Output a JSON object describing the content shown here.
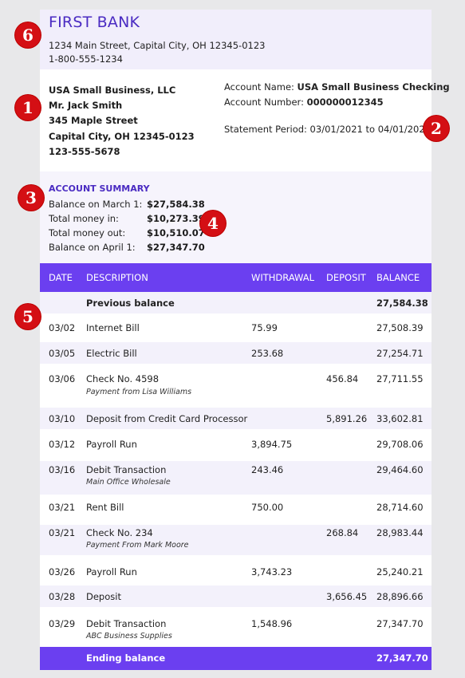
{
  "bank": {
    "name": "FIRST BANK",
    "address": "1234 Main Street, Capital City, OH 12345-0123",
    "phone": "1-800-555-1234"
  },
  "customer": {
    "business": "USA Small Business, LLC",
    "contact": "Mr. Jack Smith",
    "street": "345 Maple Street",
    "city": "Capital City, OH 12345-0123",
    "phone": "123-555-5678"
  },
  "account": {
    "name_label": "Account Name:",
    "name_value": "USA Small Business Checking",
    "number_label": "Account Number:",
    "number_value": "000000012345",
    "period": "Statement Period: 03/01/2021 to 04/01/2021"
  },
  "summary": {
    "title": "ACCOUNT SUMMARY",
    "items": [
      {
        "label": "Balance on March 1:",
        "value": "$27,584.38"
      },
      {
        "label": "Total money in:",
        "value": "$10,273.39"
      },
      {
        "label": "Total money out:",
        "value": "$10,510.07"
      },
      {
        "label": "Balance on April 1:",
        "value": "$27,347.70"
      }
    ]
  },
  "table": {
    "headers": {
      "date": "DATE",
      "description": "DESCRIPTION",
      "withdrawal": "WITHDRAWAL",
      "deposit": "DEPOSIT",
      "balance": "BALANCE"
    },
    "previous": {
      "label": "Previous balance",
      "balance": "27,584.38"
    },
    "rows": [
      {
        "date": "03/02",
        "desc": "Internet Bill",
        "sub": "",
        "withdrawal": "75.99",
        "deposit": "",
        "balance": "27,508.39"
      },
      {
        "date": "03/05",
        "desc": "Electric Bill",
        "sub": "",
        "withdrawal": "253.68",
        "deposit": "",
        "balance": "27,254.71"
      },
      {
        "date": "03/06",
        "desc": "Check No. 4598",
        "sub": "Payment from Lisa Williams",
        "withdrawal": "",
        "deposit": "456.84",
        "balance": "27,711.55"
      },
      {
        "date": "03/10",
        "desc": "Deposit from Credit Card Processor",
        "sub": "",
        "withdrawal": "",
        "deposit": "5,891.26",
        "balance": "33,602.81"
      },
      {
        "date": "03/12",
        "desc": "Payroll Run",
        "sub": "",
        "withdrawal": "3,894.75",
        "deposit": "",
        "balance": "29,708.06"
      },
      {
        "date": "03/16",
        "desc": "Debit Transaction",
        "sub": "Main Office Wholesale",
        "withdrawal": "243.46",
        "deposit": "",
        "balance": "29,464.60"
      },
      {
        "date": "03/21",
        "desc": "Rent Bill",
        "sub": "",
        "withdrawal": "750.00",
        "deposit": "",
        "balance": "28,714.60"
      },
      {
        "date": "03/21",
        "desc": "Check No. 234",
        "sub": "Payment From Mark Moore",
        "withdrawal": "",
        "deposit": "268.84",
        "balance": "28,983.44"
      },
      {
        "date": "03/26",
        "desc": "Payroll Run",
        "sub": "",
        "withdrawal": "3,743.23",
        "deposit": "",
        "balance": "25,240.21"
      },
      {
        "date": "03/28",
        "desc": "Deposit",
        "sub": "",
        "withdrawal": "",
        "deposit": "3,656.45",
        "balance": "28,896.66"
      },
      {
        "date": "03/29",
        "desc": "Debit Transaction",
        "sub": "ABC Business Supplies",
        "withdrawal": "1,548.96",
        "deposit": "",
        "balance": "27,347.70"
      }
    ],
    "ending": {
      "label": "Ending balance",
      "balance": "27,347.70"
    }
  },
  "badges": [
    "1",
    "2",
    "3",
    "4",
    "5",
    "6"
  ],
  "colors": {
    "accent": "#6b3ff0",
    "brand_text": "#4a2bc2",
    "badge": "#d40f14"
  }
}
